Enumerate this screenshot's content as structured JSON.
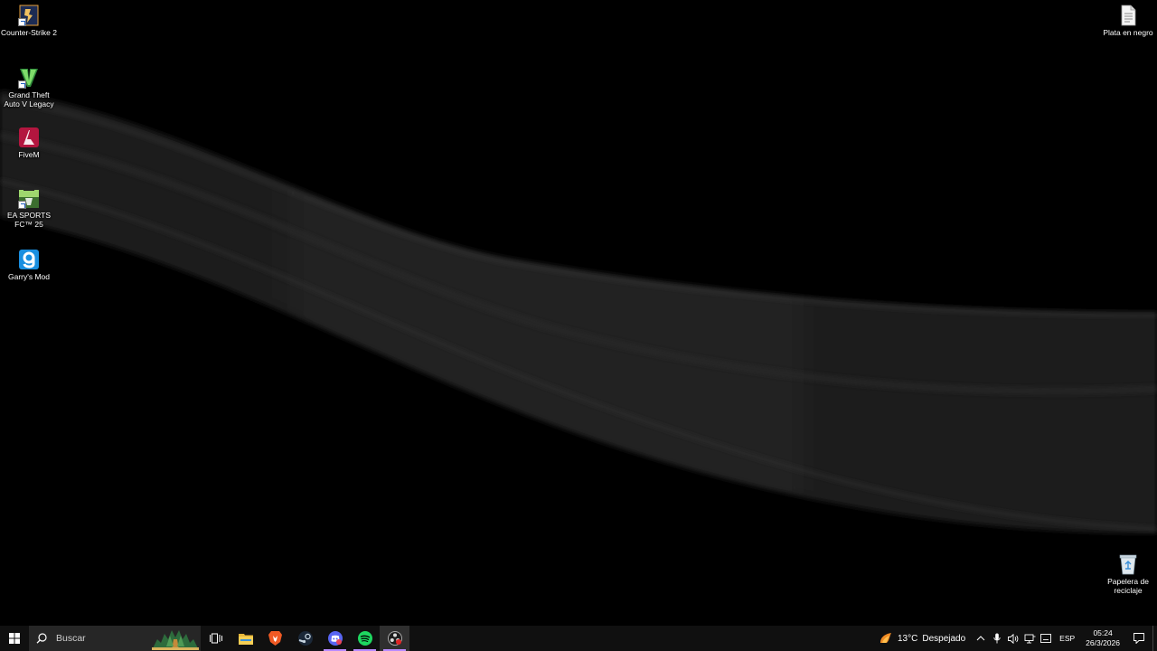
{
  "desktop": {
    "icons_left": [
      {
        "label": "Counter-Strike 2",
        "icon": "counter-strike-icon"
      },
      {
        "label": "Grand Theft Auto V Legacy",
        "icon": "gta-v-icon"
      },
      {
        "label": "FiveM",
        "icon": "fivem-icon"
      },
      {
        "label": "EA SPORTS FC™ 25",
        "icon": "ea-fc-icon"
      },
      {
        "label": "Garry's Mod",
        "icon": "garrys-mod-icon"
      }
    ],
    "icon_right_top": {
      "label": "Plata en negro",
      "icon": "text-file-icon"
    },
    "icon_right_bottom": {
      "label": "Papelera de reciclaje",
      "icon": "recycle-bin-icon"
    }
  },
  "taskbar": {
    "search_placeholder": "Buscar",
    "apps": [
      {
        "name": "task-view",
        "icon": "task-view-icon"
      },
      {
        "name": "file-explorer",
        "icon": "folder-icon"
      },
      {
        "name": "brave",
        "icon": "brave-icon"
      },
      {
        "name": "steam",
        "icon": "steam-icon"
      },
      {
        "name": "discord",
        "icon": "discord-icon"
      },
      {
        "name": "spotify",
        "icon": "spotify-icon"
      },
      {
        "name": "obs",
        "icon": "obs-icon"
      }
    ],
    "weather": {
      "temp": "13°C",
      "condition": "Despejado"
    },
    "language": "ESP",
    "time": "05:24",
    "date": "26/3/2026"
  },
  "colors": {
    "taskbar_bg": "#101010",
    "search_bg": "#262626",
    "active_indicator": "#b98bff"
  }
}
